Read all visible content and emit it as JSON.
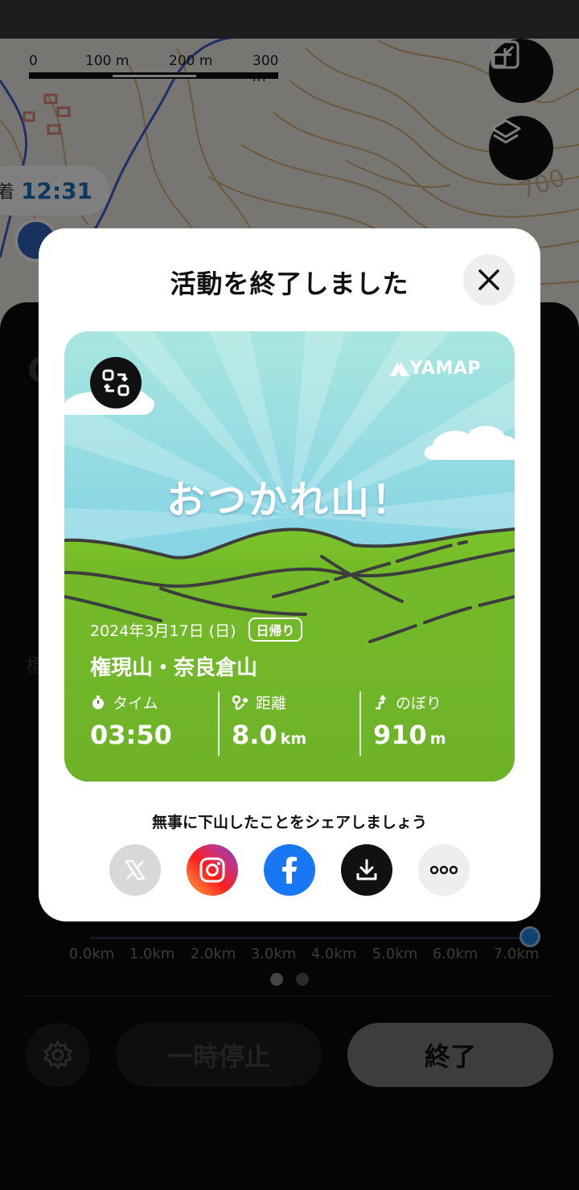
{
  "map": {
    "scale_labels": [
      "0",
      "100 m",
      "200 m",
      "300 m"
    ],
    "arrival_label": "着",
    "arrival_time": "12:31",
    "contour_label": "700"
  },
  "panel": {
    "x_axis_labels": [
      "0.0km",
      "1.0km",
      "2.0km",
      "3.0km",
      "4.0km",
      "5.0km",
      "6.0km",
      "7.0km"
    ],
    "pause_label": "一時停止",
    "end_label": "終了"
  },
  "modal": {
    "title": "活動を終了しました",
    "card": {
      "brand": "YAMAP",
      "headline": "おつかれ山！",
      "date": "2024年3月17日 (日)",
      "tag": "日帰り",
      "mountain": "権現山・奈良倉山",
      "stats": [
        {
          "label": "タイム",
          "value": "03:50",
          "unit": ""
        },
        {
          "label": "距離",
          "value": "8.0",
          "unit": "km"
        },
        {
          "label": "のぼり",
          "value": "910",
          "unit": "m"
        }
      ]
    },
    "share_text": "無事に下山したことをシェアしましょう",
    "share_buttons": [
      "x-icon",
      "instagram-icon",
      "facebook-icon",
      "download-icon",
      "more-icon"
    ]
  },
  "colors": {
    "facebook": "#1877f2",
    "arrival_time": "#1d6fb8",
    "sky_top": "#7fd3ee",
    "grass": "#4d8a22"
  }
}
